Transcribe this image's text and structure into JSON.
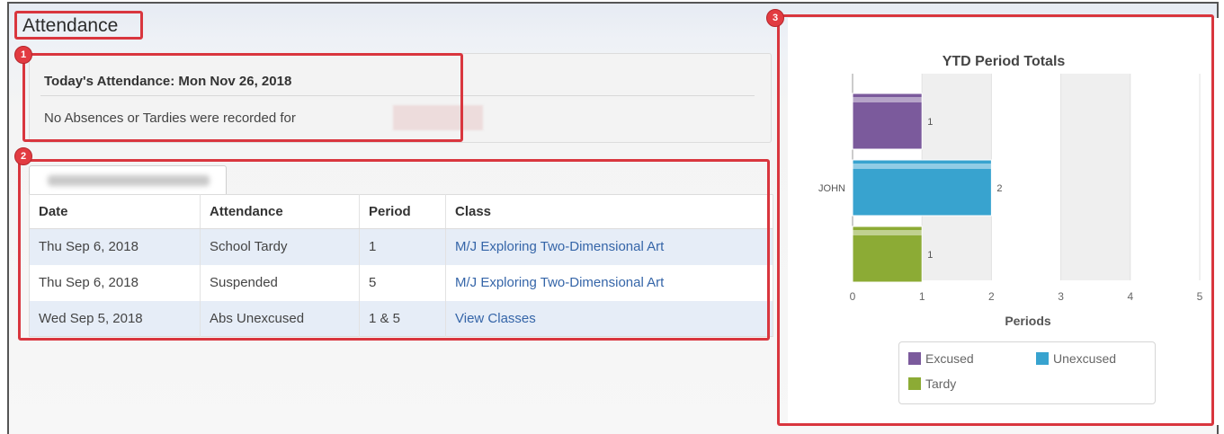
{
  "section_title": "Attendance",
  "callouts": [
    "1",
    "2",
    "3"
  ],
  "today": {
    "heading": "Today's Attendance: Mon Nov 26, 2018",
    "message": "No Absences or Tardies were recorded for"
  },
  "table": {
    "columns": [
      "Date",
      "Attendance",
      "Period",
      "Class"
    ],
    "rows": [
      {
        "date": "Thu Sep 6, 2018",
        "attendance": "School Tardy",
        "period": "1",
        "class": "M/J Exploring Two-Dimensional Art"
      },
      {
        "date": "Thu Sep 6, 2018",
        "attendance": "Suspended",
        "period": "5",
        "class": "M/J Exploring Two-Dimensional Art"
      },
      {
        "date": "Wed Sep 5, 2018",
        "attendance": "Abs Unexcused",
        "period": "1 & 5",
        "class": "View Classes"
      }
    ]
  },
  "colors": {
    "callout": "#d9363e",
    "link": "#3565a8",
    "excused": "#7b5a9c",
    "unexcused": "#38a3cf",
    "tardy": "#8cab35"
  },
  "chart_data": {
    "type": "bar",
    "orientation": "horizontal",
    "title": "YTD Period Totals",
    "xlabel": "Periods",
    "ylabel": "",
    "categories": [
      "JOHN"
    ],
    "series": [
      {
        "name": "Excused",
        "values": [
          1
        ],
        "color": "#7b5a9c"
      },
      {
        "name": "Unexcused",
        "values": [
          2
        ],
        "color": "#38a3cf"
      },
      {
        "name": "Tardy",
        "values": [
          1
        ],
        "color": "#8cab35"
      }
    ],
    "xlim": [
      0,
      5
    ],
    "xticks": [
      "0",
      "1",
      "2",
      "3",
      "4",
      "5"
    ],
    "legend": "bottom",
    "grid": "alternating-bands"
  }
}
